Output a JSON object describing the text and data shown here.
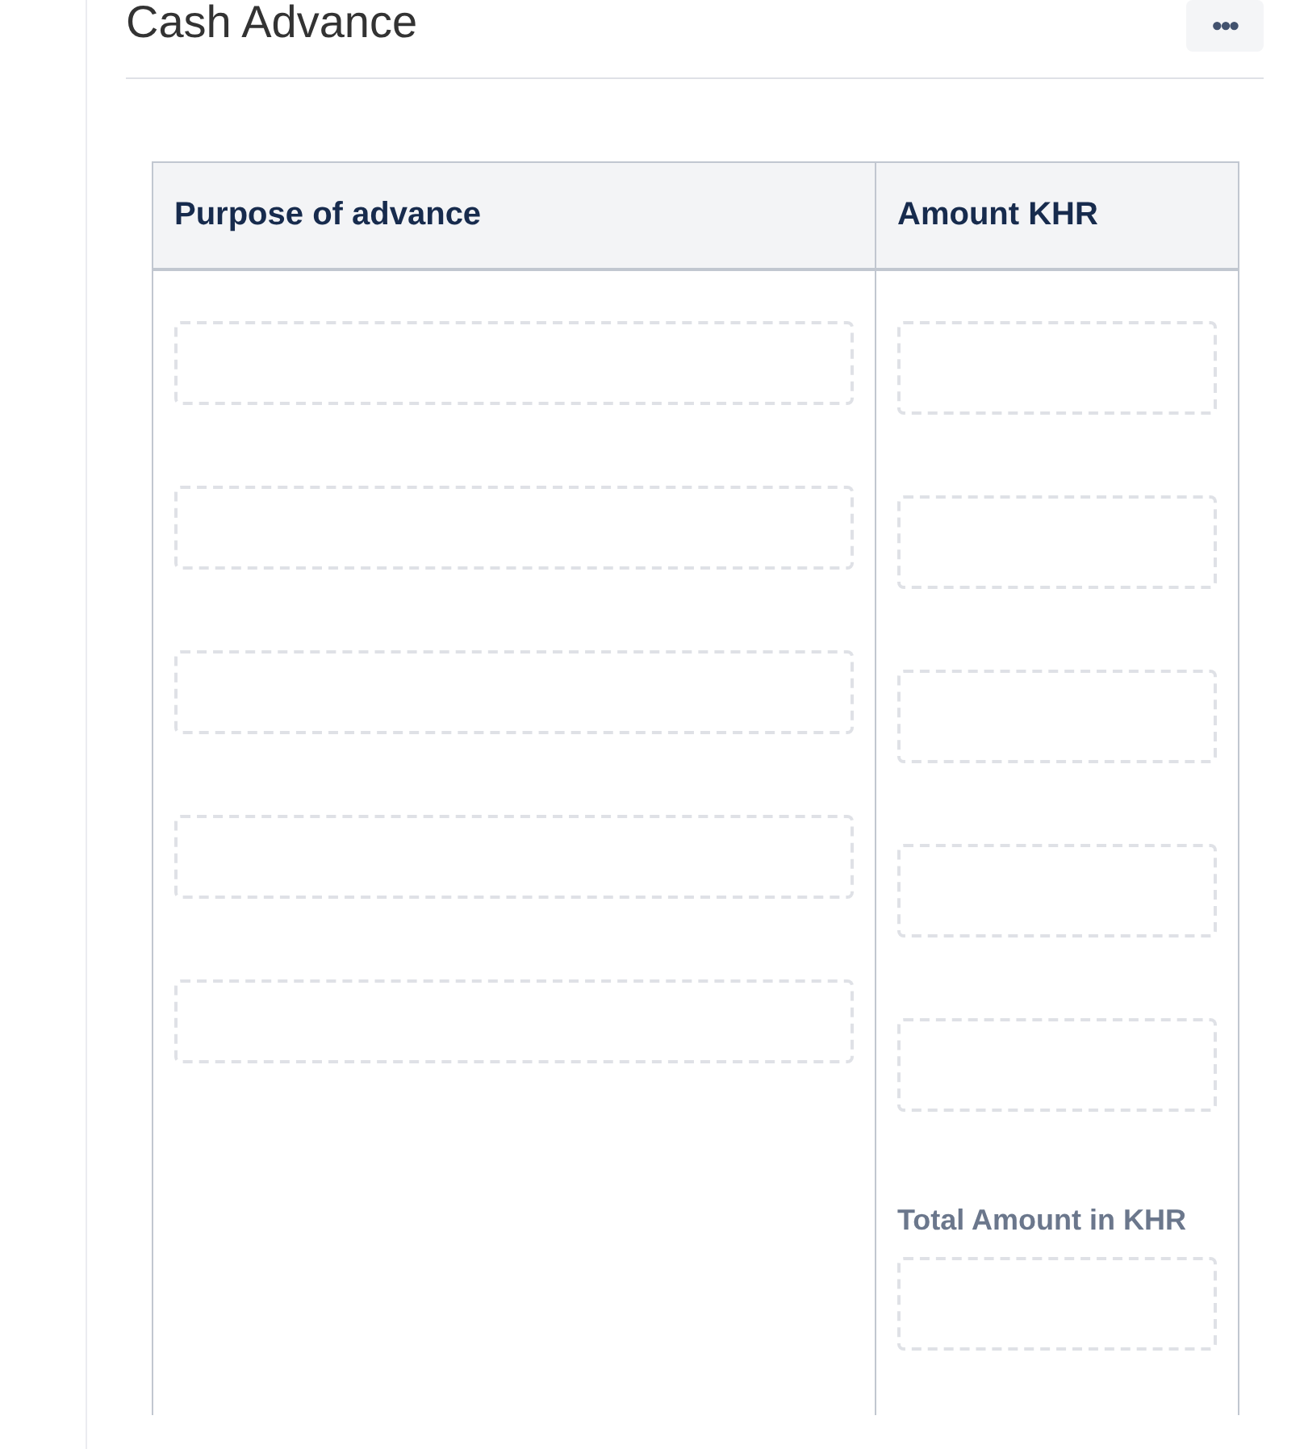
{
  "panel": {
    "title": "Cash Advance",
    "menu_button": {
      "label": "•••"
    }
  },
  "table": {
    "columns": [
      "Purpose of advance",
      "Amount KHR"
    ],
    "purpose_fields": [
      {
        "kind": "input"
      },
      {
        "kind": "input"
      },
      {
        "kind": "input"
      },
      {
        "kind": "input"
      },
      {
        "kind": "input"
      }
    ],
    "amount_fields": [
      {
        "kind": "input"
      },
      {
        "kind": "input"
      },
      {
        "kind": "input"
      },
      {
        "kind": "input"
      },
      {
        "kind": "input"
      }
    ],
    "total": {
      "label": "Total Amount in KHR"
    }
  }
}
